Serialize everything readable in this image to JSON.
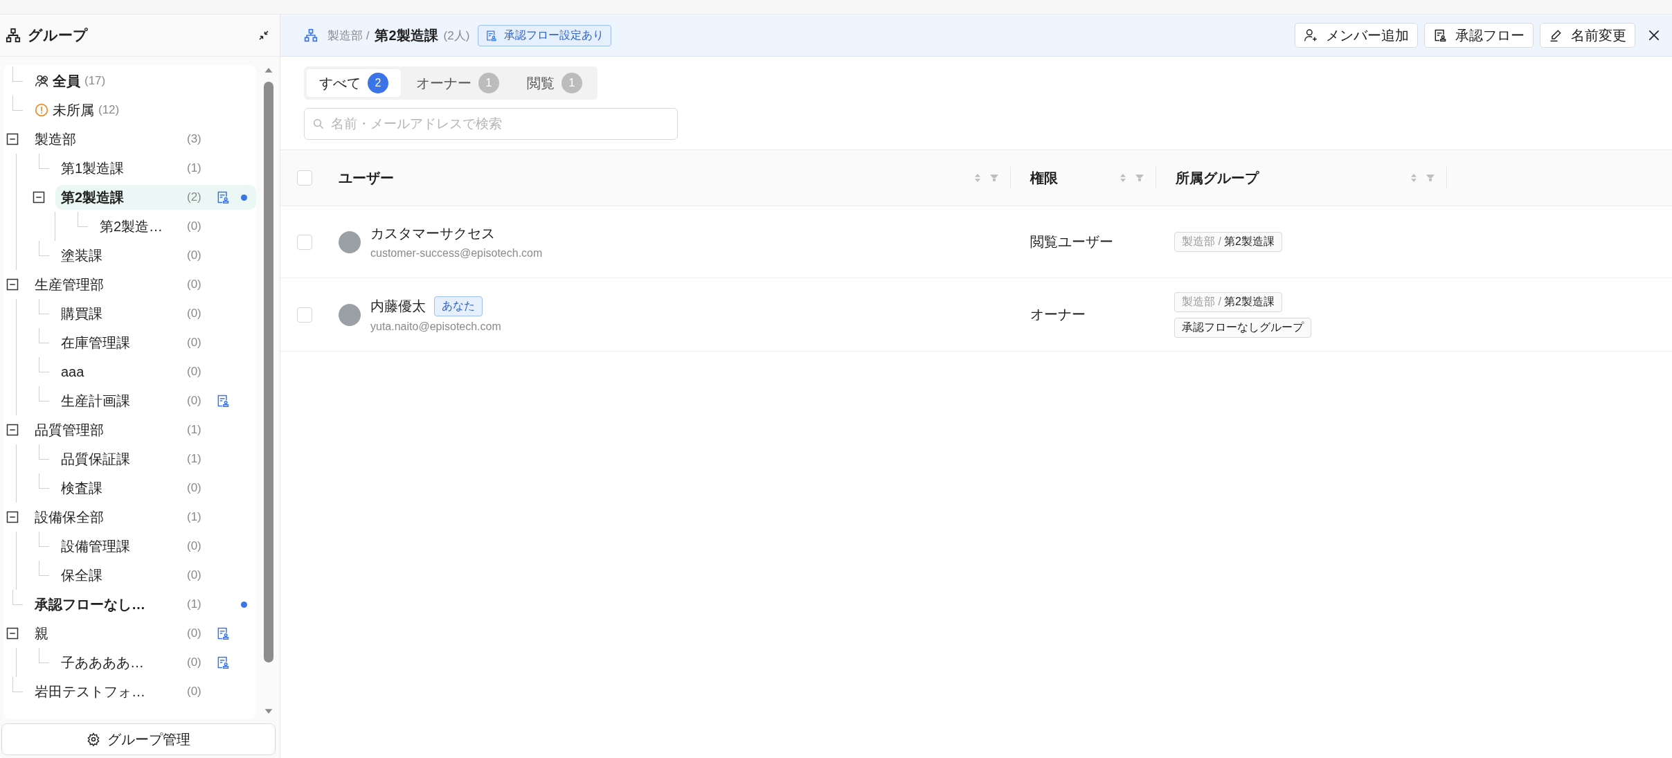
{
  "sidebar": {
    "title": "グループ",
    "tree": [
      {
        "kind": "all",
        "label": "全員",
        "count": "(17)",
        "bold": true,
        "selected": false
      },
      {
        "kind": "unassigned",
        "label": "未所属",
        "count": "(12)",
        "bold": false,
        "selected": false
      },
      {
        "kind": "group",
        "label": "製造部",
        "count": "(3)",
        "bold": false,
        "selected": false,
        "expanded": true,
        "children": [
          {
            "kind": "group",
            "label": "第1製造課",
            "count": "(1)",
            "bold": false,
            "selected": false
          },
          {
            "kind": "group",
            "label": "第2製造課",
            "count": "(2)",
            "bold": true,
            "selected": true,
            "approval_flow": true,
            "member_dot": true,
            "expanded": true,
            "children": [
              {
                "kind": "group",
                "label": "第2製造…",
                "count": "(0)",
                "bold": false,
                "selected": false
              }
            ]
          },
          {
            "kind": "group",
            "label": "塗装課",
            "count": "(0)",
            "bold": false,
            "selected": false
          }
        ]
      },
      {
        "kind": "group",
        "label": "生産管理部",
        "count": "(0)",
        "bold": false,
        "selected": false,
        "expanded": true,
        "children": [
          {
            "kind": "group",
            "label": "購買課",
            "count": "(0)",
            "bold": false,
            "selected": false
          },
          {
            "kind": "group",
            "label": "在庫管理課",
            "count": "(0)",
            "bold": false,
            "selected": false
          },
          {
            "kind": "group",
            "label": "aaa",
            "count": "(0)",
            "bold": false,
            "selected": false
          },
          {
            "kind": "group",
            "label": "生産計画課",
            "count": "(0)",
            "bold": false,
            "selected": false,
            "approval_flow": true
          }
        ]
      },
      {
        "kind": "group",
        "label": "品質管理部",
        "count": "(1)",
        "bold": false,
        "selected": false,
        "expanded": true,
        "children": [
          {
            "kind": "group",
            "label": "品質保証課",
            "count": "(1)",
            "bold": false,
            "selected": false
          },
          {
            "kind": "group",
            "label": "検査課",
            "count": "(0)",
            "bold": false,
            "selected": false
          }
        ]
      },
      {
        "kind": "group",
        "label": "設備保全部",
        "count": "(1)",
        "bold": false,
        "selected": false,
        "expanded": true,
        "children": [
          {
            "kind": "group",
            "label": "設備管理課",
            "count": "(0)",
            "bold": false,
            "selected": false
          },
          {
            "kind": "group",
            "label": "保全課",
            "count": "(0)",
            "bold": false,
            "selected": false
          }
        ]
      },
      {
        "kind": "group",
        "label": "承認フローなし…",
        "count": "(1)",
        "bold": true,
        "selected": false,
        "member_dot": true
      },
      {
        "kind": "group",
        "label": "親",
        "count": "(0)",
        "bold": false,
        "selected": false,
        "approval_flow": true,
        "expanded": true,
        "children": [
          {
            "kind": "group",
            "label": "子ああああ…",
            "count": "(0)",
            "bold": false,
            "selected": false,
            "approval_flow": true
          }
        ]
      },
      {
        "kind": "group",
        "label": "岩田テストフォ…",
        "count": "(0)",
        "bold": false,
        "selected": false
      }
    ],
    "manage_button": "グループ管理"
  },
  "header": {
    "parent": "製造部 /",
    "title": "第2製造課",
    "member_count": "(2人)",
    "flow_badge": "承認フロー設定あり",
    "actions": [
      {
        "kind": "add-member",
        "label": "メンバー追加"
      },
      {
        "kind": "flow",
        "label": "承認フロー"
      },
      {
        "kind": "rename",
        "label": "名前変更"
      }
    ]
  },
  "tabs": [
    {
      "label": "すべて",
      "count": "2",
      "selected": true
    },
    {
      "label": "オーナー",
      "count": "1",
      "selected": false
    },
    {
      "label": "閲覧",
      "count": "1",
      "selected": false
    }
  ],
  "search": {
    "placeholder": "名前・メールアドレスで検索"
  },
  "table": {
    "select_all_checked": false,
    "columns": [
      {
        "label": "ユーザー"
      },
      {
        "label": "権限"
      },
      {
        "label": "所属グループ"
      }
    ],
    "rows": [
      {
        "checked": false,
        "name": "カスタマーサクセス",
        "email": "customer-success@episotech.com",
        "role": "閲覧ユーザー",
        "groups": [
          {
            "parent": "製造部 /",
            "name": "第2製造課"
          }
        ]
      },
      {
        "checked": false,
        "name": "内藤優太",
        "badge": "あなた",
        "email": "yuta.naito@episotech.com",
        "role": "オーナー",
        "groups": [
          {
            "parent": "製造部 /",
            "name": "第2製造課"
          },
          {
            "name": "承認フローなしグループ"
          }
        ]
      }
    ]
  }
}
